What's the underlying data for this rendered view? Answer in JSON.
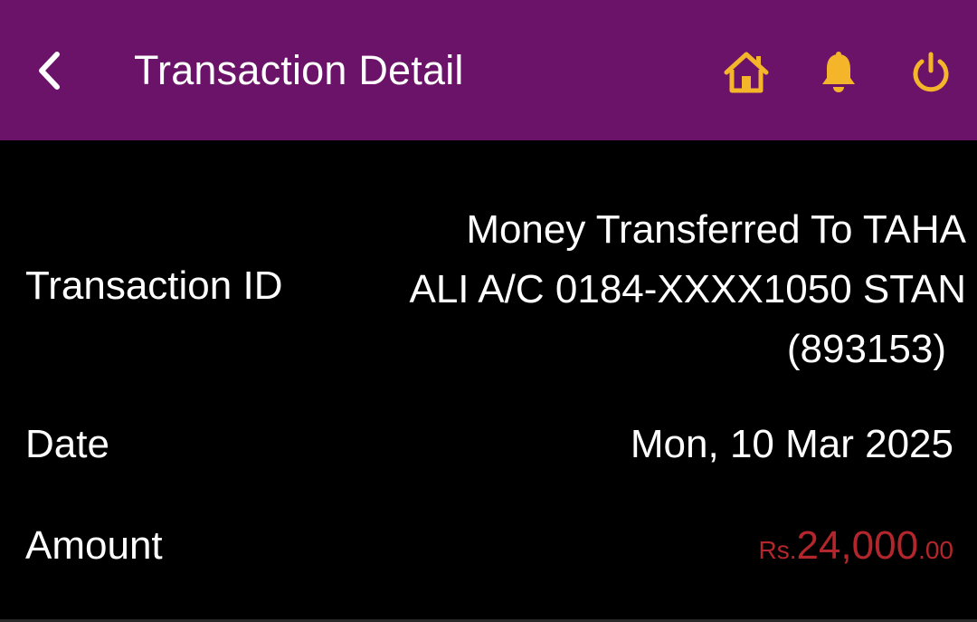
{
  "header": {
    "title": "Transaction Detail",
    "back_icon": "chevron-left-icon",
    "home_icon": "home-icon",
    "bell_icon": "bell-icon",
    "power_icon": "power-icon",
    "background_color": "#6b1369",
    "icon_color": "#f5b52a"
  },
  "details": {
    "transaction_id_label": "Transaction ID",
    "transaction_id_value_line1": "Money Transferred To TAHA",
    "transaction_id_value_line2": "ALI A/C 0184-XXXX1050 STAN",
    "transaction_id_value_line3": "(893153)",
    "date_label": "Date",
    "date_value": "Mon, 10 Mar 2025",
    "amount_label": "Amount",
    "amount_currency": "Rs.",
    "amount_main": "24,000",
    "amount_decimal": ".00",
    "amount_color": "#b3262b"
  }
}
